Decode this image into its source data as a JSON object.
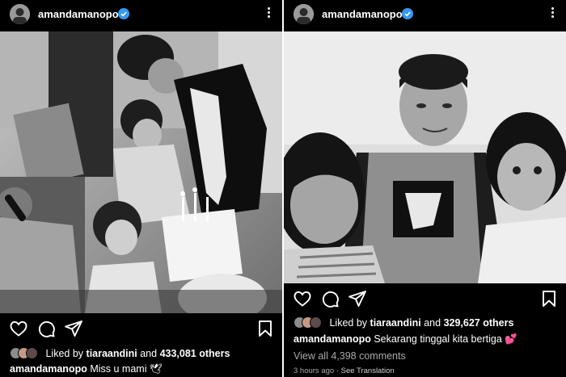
{
  "post1": {
    "username": "amandamanopo",
    "icons": {
      "avatar": "profile-avatar",
      "verified": "verified-badge-icon",
      "more": "more-options-icon",
      "like": "heart-icon",
      "comment": "comment-icon",
      "share": "send-icon",
      "save": "bookmark-icon"
    },
    "liked_by_prefix": "Liked by",
    "liked_by_user": "tiaraandini",
    "liked_by_and": "and",
    "liked_by_count": "433,081 others",
    "caption_user": "amandamanopo",
    "caption_text": "Miss u mami",
    "caption_emoji": "🕊",
    "photo_desc": "black and white photo of a birthday celebration with cake and candles"
  },
  "post2": {
    "username": "amandamanopo",
    "liked_by_prefix": "Liked by",
    "liked_by_user": "tiaraandini",
    "liked_by_and": "and",
    "liked_by_count": "329,627 others",
    "caption_user": "amandamanopo",
    "caption_text": "Sekarang tinggal kita bertiga",
    "caption_emoji": "💕",
    "view_comments": "View all 4,398 comments",
    "time_ago": "3 hours ago",
    "dot": "·",
    "see_translation": "See Translation"
  },
  "colors": {
    "verified": "#3797f0",
    "background": "#000000",
    "secondary_text": "#a8a8a8",
    "emoji_pink": "#ff4fa3"
  }
}
